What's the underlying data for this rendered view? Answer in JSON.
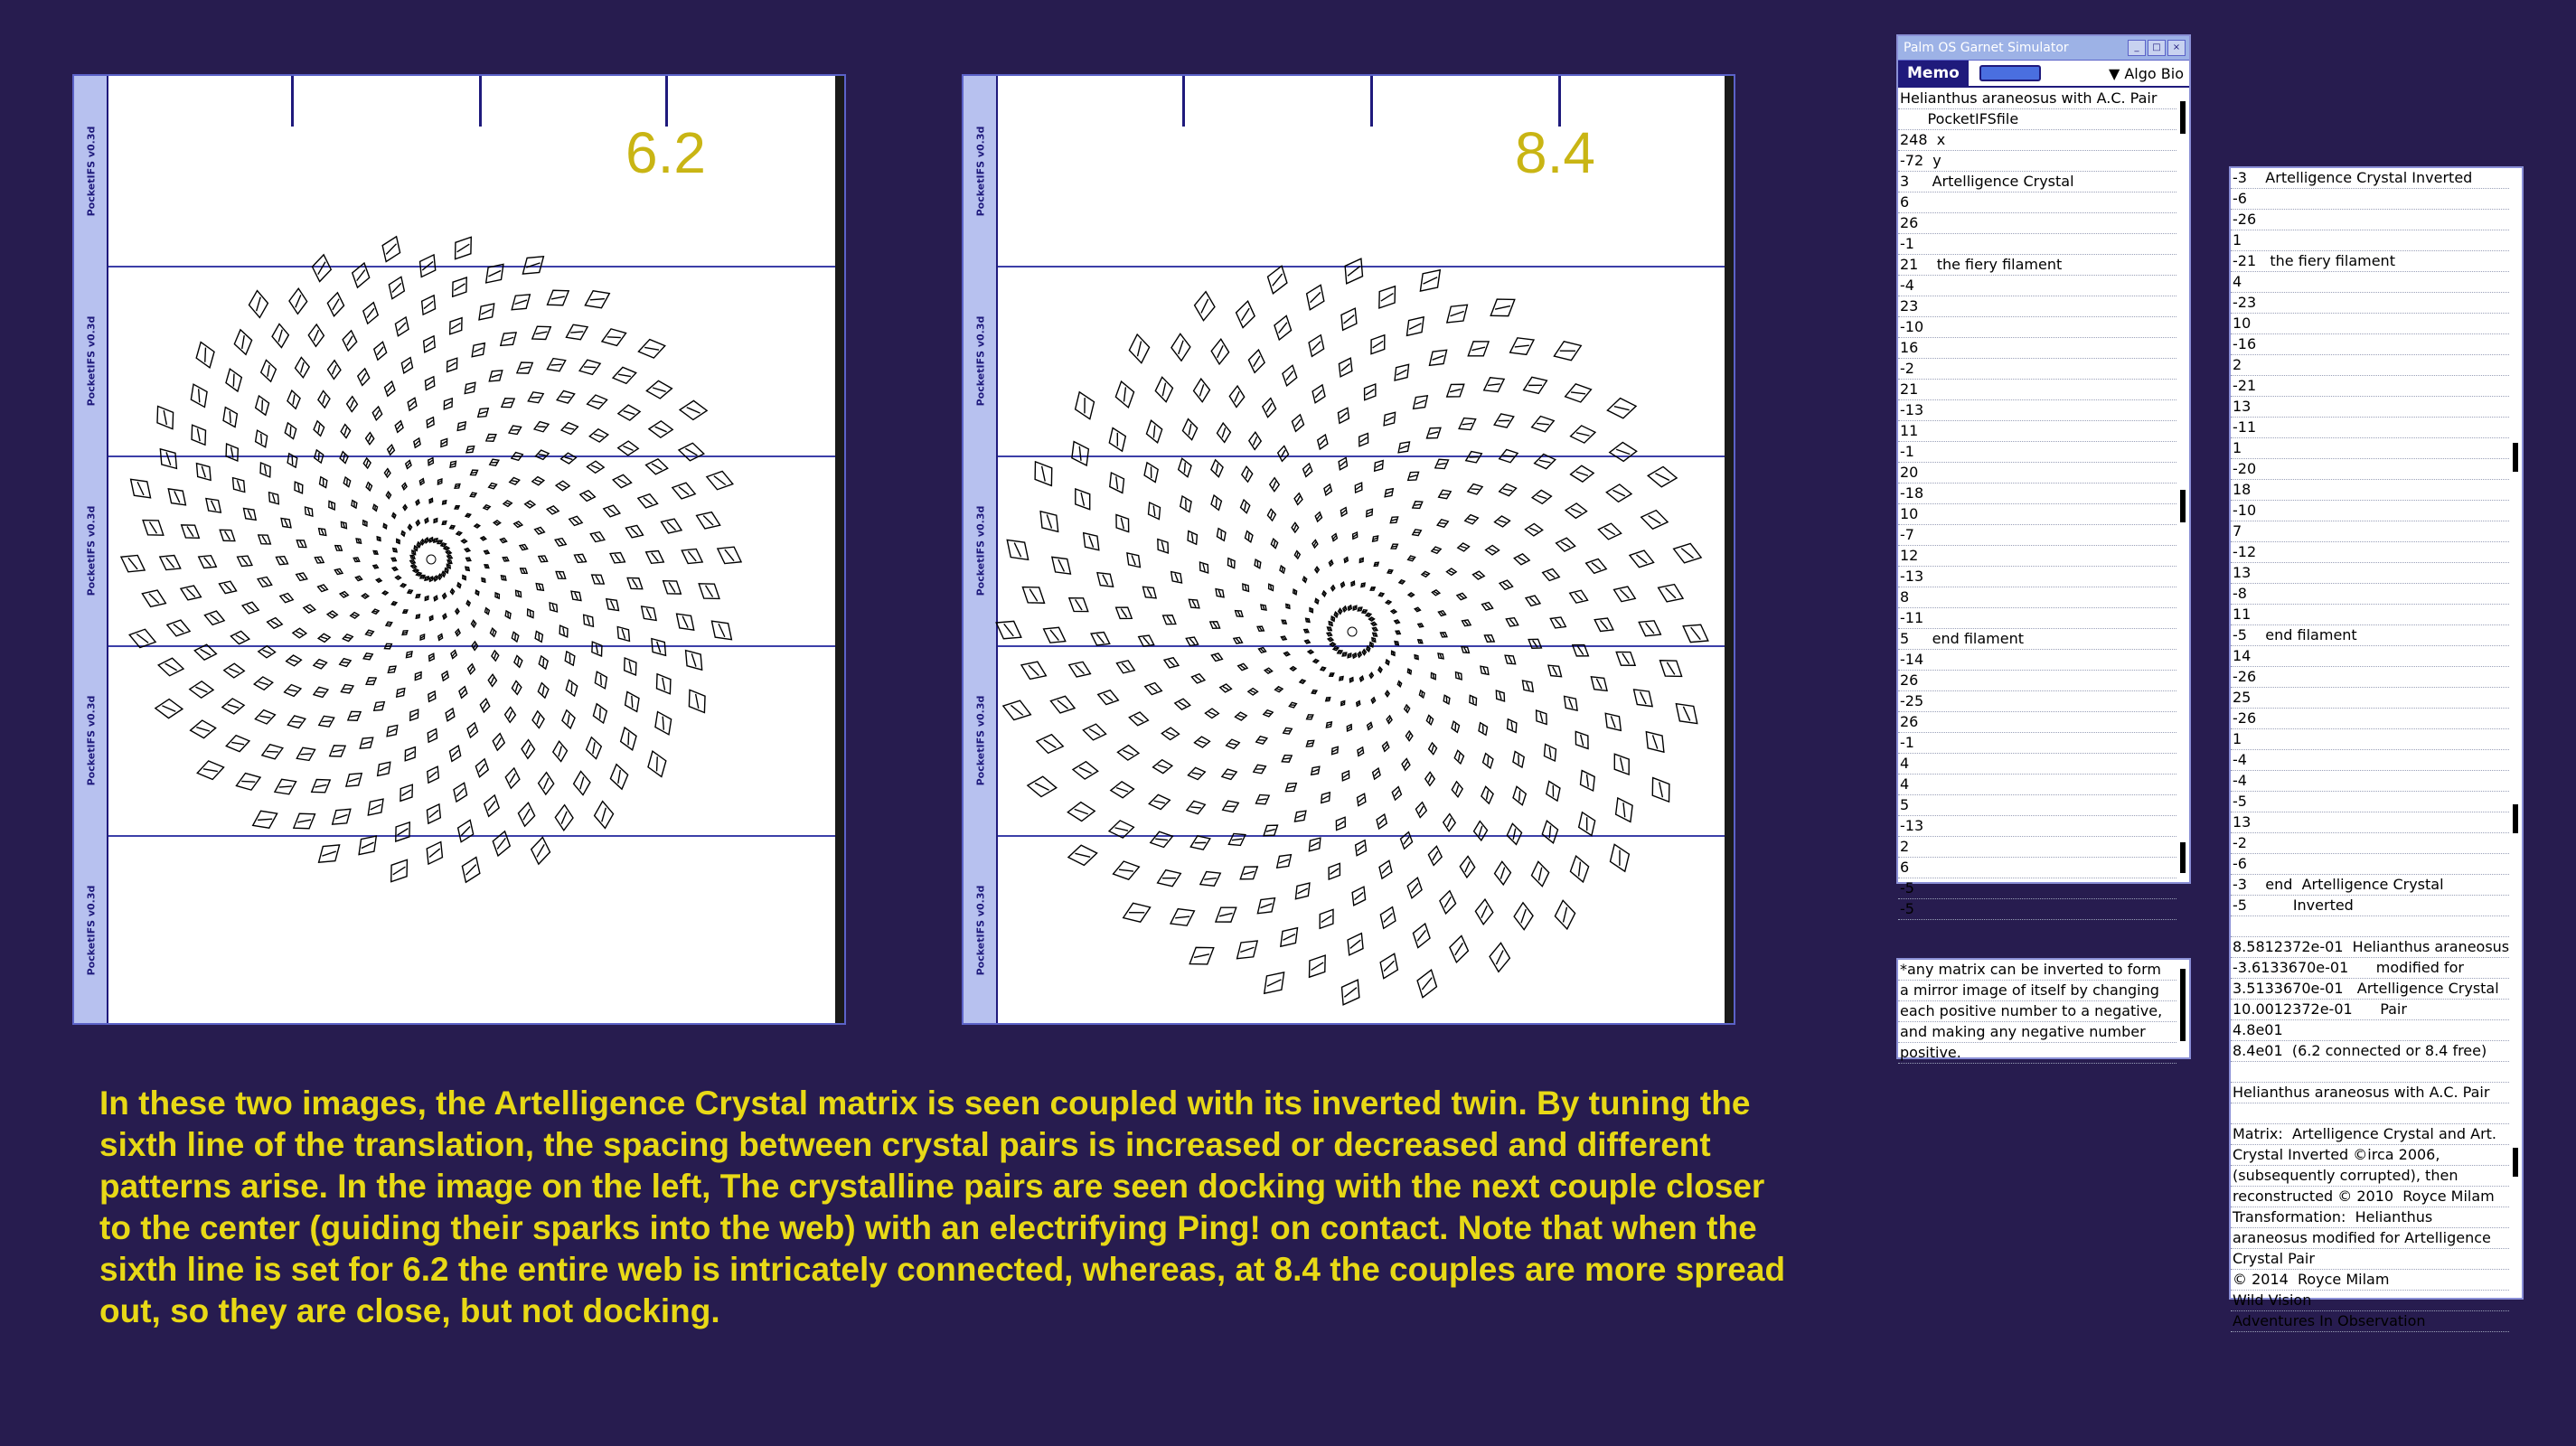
{
  "left_plot": {
    "param": "6.2",
    "side_label": "PocketIFS v0.3d"
  },
  "right_plot": {
    "param": "8.4",
    "side_label": "PocketIFS v0.3d"
  },
  "palm_window": {
    "title": "Palm OS Garnet Simulator",
    "memo_label": "Memo",
    "category": "Algo Bio",
    "lines": [
      "Helianthus araneosus with A.C. Pair",
      "      PocketIFSfile",
      "248  x",
      "-72  y",
      "3     Artelligence Crystal",
      "6",
      "26",
      "-1",
      "21    the fiery filament",
      "-4",
      "23",
      "-10",
      "16",
      "-2",
      "21",
      "-13",
      "11",
      "-1",
      "20",
      "-18",
      "10",
      "-7",
      "12",
      "-13",
      "8",
      "-11",
      "5     end filament",
      "-14",
      "26",
      "-25",
      "26",
      "-1",
      "4",
      "4",
      "5",
      "-13",
      "2",
      "6",
      "-5",
      "-5"
    ]
  },
  "note_window": {
    "lines": [
      "*any matrix can be inverted to form",
      "a mirror image of itself by changing",
      "each positive number to a negative,",
      "and making any negative number",
      "positive."
    ]
  },
  "inverted_window": {
    "lines": [
      "-3    Artelligence Crystal Inverted",
      "-6",
      "-26",
      "1",
      "-21   the fiery filament",
      "4",
      "-23",
      "10",
      "-16",
      "2",
      "-21",
      "13",
      "-11",
      "1",
      "-20",
      "18",
      "-10",
      "7",
      "-12",
      "13",
      "-8",
      "11",
      "-5    end filament",
      "14",
      "-26",
      "25",
      "-26",
      "1",
      "-4",
      "-4",
      "-5",
      "13",
      "-2",
      "-6",
      "-3    end  Artelligence Crystal",
      "-5          Inverted",
      "",
      "8.5812372e-01  Helianthus araneosus",
      "-3.6133670e-01      modified for",
      "3.5133670e-01   Artelligence Crystal",
      "10.0012372e-01      Pair",
      "4.8e01",
      "8.4e01  (6.2 connected or 8.4 free)",
      "",
      "Helianthus araneosus with A.C. Pair",
      "",
      "Matrix:  Artelligence Crystal and Art.",
      "Crystal Inverted ©irca 2006,",
      "(subsequently corrupted), then",
      "reconstructed © 2010  Royce Milam",
      "Transformation:  Helianthus",
      "araneosus modified for Artelligence",
      "Crystal Pair",
      "© 2014  Royce Milam",
      "Wild Vision",
      "Adventures In Observation"
    ]
  },
  "caption": "In these two images, the Artelligence Crystal matrix is seen coupled with its inverted twin.  By tuning the sixth line of the translation, the spacing between crystal pairs is increased or decreased and different patterns arise.  In the image on the left, The crystalline pairs are seen docking with the next couple closer to the center (guiding their sparks into the web) with an electrifying Ping! on contact.  Note that when the sixth line is set for 6.2 the entire web is intricately connected, whereas, at 8.4 the couples are more spread out, so they are close, but not docking."
}
